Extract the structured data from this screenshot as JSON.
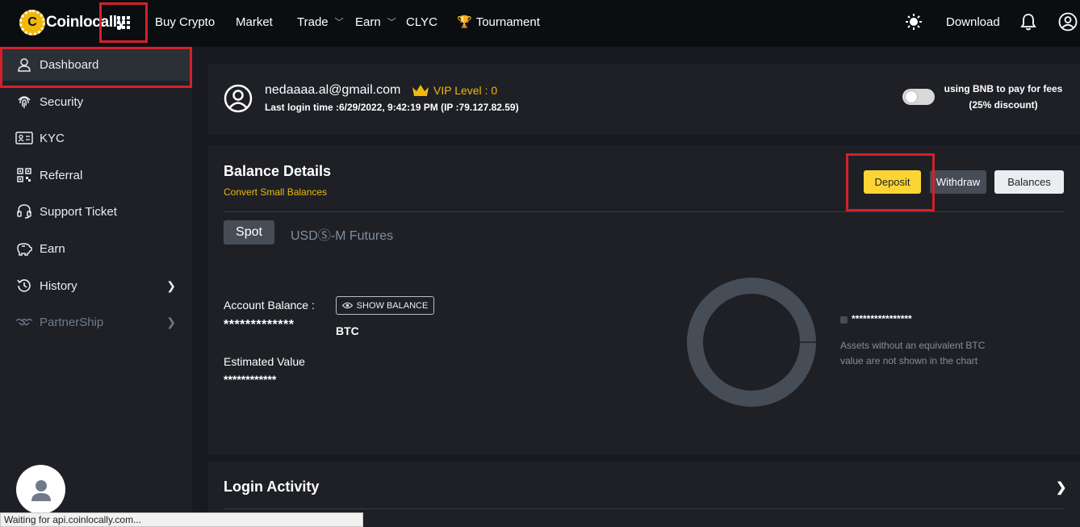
{
  "brand": {
    "name": "Coinlocally",
    "logo_letter": "C"
  },
  "nav": {
    "items": [
      "Buy Crypto",
      "Market",
      "Trade",
      "Earn",
      "CLYC",
      "Tournament"
    ],
    "download": "Download"
  },
  "sidebar": {
    "items": [
      {
        "label": "Dashboard",
        "icon": "user-icon",
        "active": true
      },
      {
        "label": "Security",
        "icon": "fingerprint-icon"
      },
      {
        "label": "KYC",
        "icon": "id-card-icon"
      },
      {
        "label": "Referral",
        "icon": "qr-code-icon"
      },
      {
        "label": "Support Ticket",
        "icon": "headset-icon"
      },
      {
        "label": "Earn",
        "icon": "piggy-bank-icon"
      },
      {
        "label": "History",
        "icon": "history-icon"
      },
      {
        "label": "PartnerShip",
        "icon": "handshake-icon",
        "disabled": true
      }
    ]
  },
  "profile": {
    "email": "nedaaaa.al@gmail.com",
    "vip": "VIP Level : 0",
    "last_login": "Last login time :6/29/2022, 9:42:19 PM (IP :79.127.82.59)",
    "bnb_line1": "using BNB to pay for fees",
    "bnb_line2": "(25% discount)",
    "bnb_toggle_on": false
  },
  "balance": {
    "title": "Balance Details",
    "convert_link": "Convert Small Balances",
    "deposit": "Deposit",
    "withdraw": "Withdraw",
    "balances": "Balances",
    "tabs": [
      "Spot",
      "USDⓈ-M Futures"
    ],
    "account_label": "Account Balance :",
    "show_balance": "SHOW BALANCE",
    "account_value": "*************",
    "account_unit": "BTC",
    "estimated_label": "Estimated Value",
    "estimated_value": "************",
    "legend_value": "****************",
    "legend_note": "Assets without an equivalent BTC value are not shown in the chart"
  },
  "login_activity": {
    "title": "Login Activity"
  },
  "status_bar": "Waiting for api.coinlocally.com..."
}
